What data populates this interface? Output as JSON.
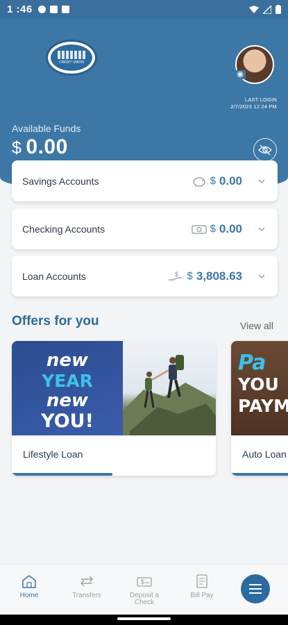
{
  "status_bar": {
    "time": "1 :46"
  },
  "header": {
    "logo_text": "CREDIT UNION",
    "last_login_label": "LAST LOGIN",
    "last_login_value": "2/7/2023 12:24 PM",
    "funds_label": "Available Funds",
    "funds_currency": "$",
    "funds_amount": "0.00"
  },
  "accounts": [
    {
      "name": "Savings Accounts",
      "icon": "piggy-bank-icon",
      "currency": "$",
      "amount": "0.00"
    },
    {
      "name": "Checking Accounts",
      "icon": "cash-icon",
      "currency": "$",
      "amount": "0.00"
    },
    {
      "name": "Loan Accounts",
      "icon": "loan-hand-icon",
      "currency": "$",
      "amount": "3,808.63"
    }
  ],
  "offers": {
    "title": "Offers for you",
    "view_all": "View all",
    "items": [
      {
        "label": "Lifestyle Loan",
        "banner": [
          "new",
          "YEAR",
          "new",
          "YOU!"
        ]
      },
      {
        "label": "Auto Loan",
        "banner": [
          "Pa",
          "YOU",
          "PAYM"
        ]
      }
    ]
  },
  "nav": {
    "items": [
      {
        "label": "Home",
        "icon": "home-icon",
        "active": true
      },
      {
        "label": "Transfers",
        "icon": "transfer-icon",
        "active": false
      },
      {
        "label": "Deposit a Check",
        "icon": "check-icon",
        "active": false
      },
      {
        "label": "Bill Pay",
        "icon": "bill-icon",
        "active": false
      }
    ],
    "menu_icon": "hamburger-icon"
  },
  "colors": {
    "brand_blue": "#3c77a6",
    "dark_blue": "#2c6aa0",
    "accent_cyan": "#3ec1e9",
    "background": "#f2f4f6"
  }
}
